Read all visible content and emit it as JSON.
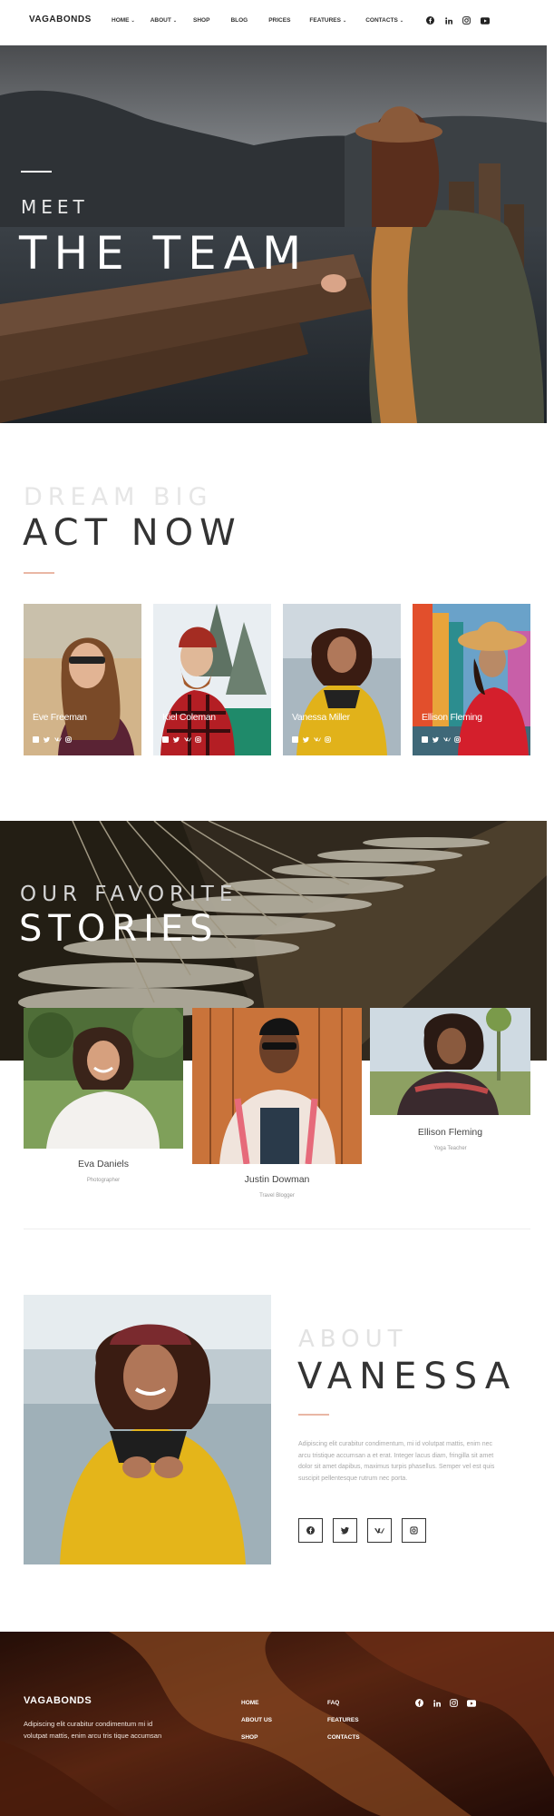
{
  "header": {
    "logo": "VAGABONDS",
    "nav": [
      {
        "label": "HOME",
        "dropdown": true
      },
      {
        "label": "ABOUT",
        "dropdown": true
      },
      {
        "label": "SHOP",
        "dropdown": false
      },
      {
        "label": "BLOG",
        "dropdown": false
      },
      {
        "label": "PRICES",
        "dropdown": false
      },
      {
        "label": "FEATURES",
        "dropdown": true
      },
      {
        "label": "CONTACTS",
        "dropdown": true
      }
    ],
    "social": [
      "facebook-icon",
      "linkedin-icon",
      "instagram-icon",
      "youtube-icon"
    ]
  },
  "hero": {
    "subtitle": "MEET",
    "title": "THE TEAM"
  },
  "team": {
    "subtitle": "DREAM BIG",
    "title": "ACT NOW",
    "members": [
      {
        "name": "Eve Freeman"
      },
      {
        "name": "Kiel Coleman"
      },
      {
        "name": "Vanessa Miller"
      },
      {
        "name": "Ellison Fleming"
      }
    ],
    "card_social": [
      "facebook-icon",
      "twitter-icon",
      "vk-icon",
      "instagram-icon"
    ]
  },
  "stories": {
    "subtitle": "OUR FAVORITE",
    "title": "STORIES",
    "items": [
      {
        "name": "Eva Daniels",
        "role": "Photographer"
      },
      {
        "name": "Justin Dowman",
        "role": "Travel Blogger"
      },
      {
        "name": "Ellison Fleming",
        "role": "Yoga Teacher"
      }
    ]
  },
  "about": {
    "subtitle": "ABOUT",
    "title": "VANESSA",
    "text": "Adipiscing elit curabitur condimentum, mi id volutpat mattis, enim nec arcu tristique accumsan a et erat. Integer lacus diam, fringilla sit amet dolor sit amet dapibus, maximus turpis phasellus. Semper vel est quis suscipit pellentesque rutrum nec porta.",
    "social": [
      "facebook-icon",
      "twitter-icon",
      "vk-icon",
      "instagram-icon"
    ]
  },
  "footer": {
    "logo": "VAGABONDS",
    "text": "Adipiscing elit curabitur condimentum mi id volutpat mattis, enim arcu tris tique accumsan",
    "col1": [
      "HOME",
      "ABOUT US",
      "SHOP"
    ],
    "col2": [
      "FAQ",
      "FEATURES",
      "CONTACTS"
    ],
    "social": [
      "facebook-icon",
      "linkedin-icon",
      "instagram-icon",
      "youtube-icon"
    ]
  },
  "colors": {
    "accent": "#e9b7a5",
    "dark": "#333333",
    "footer_bg": "#3a1a10"
  }
}
